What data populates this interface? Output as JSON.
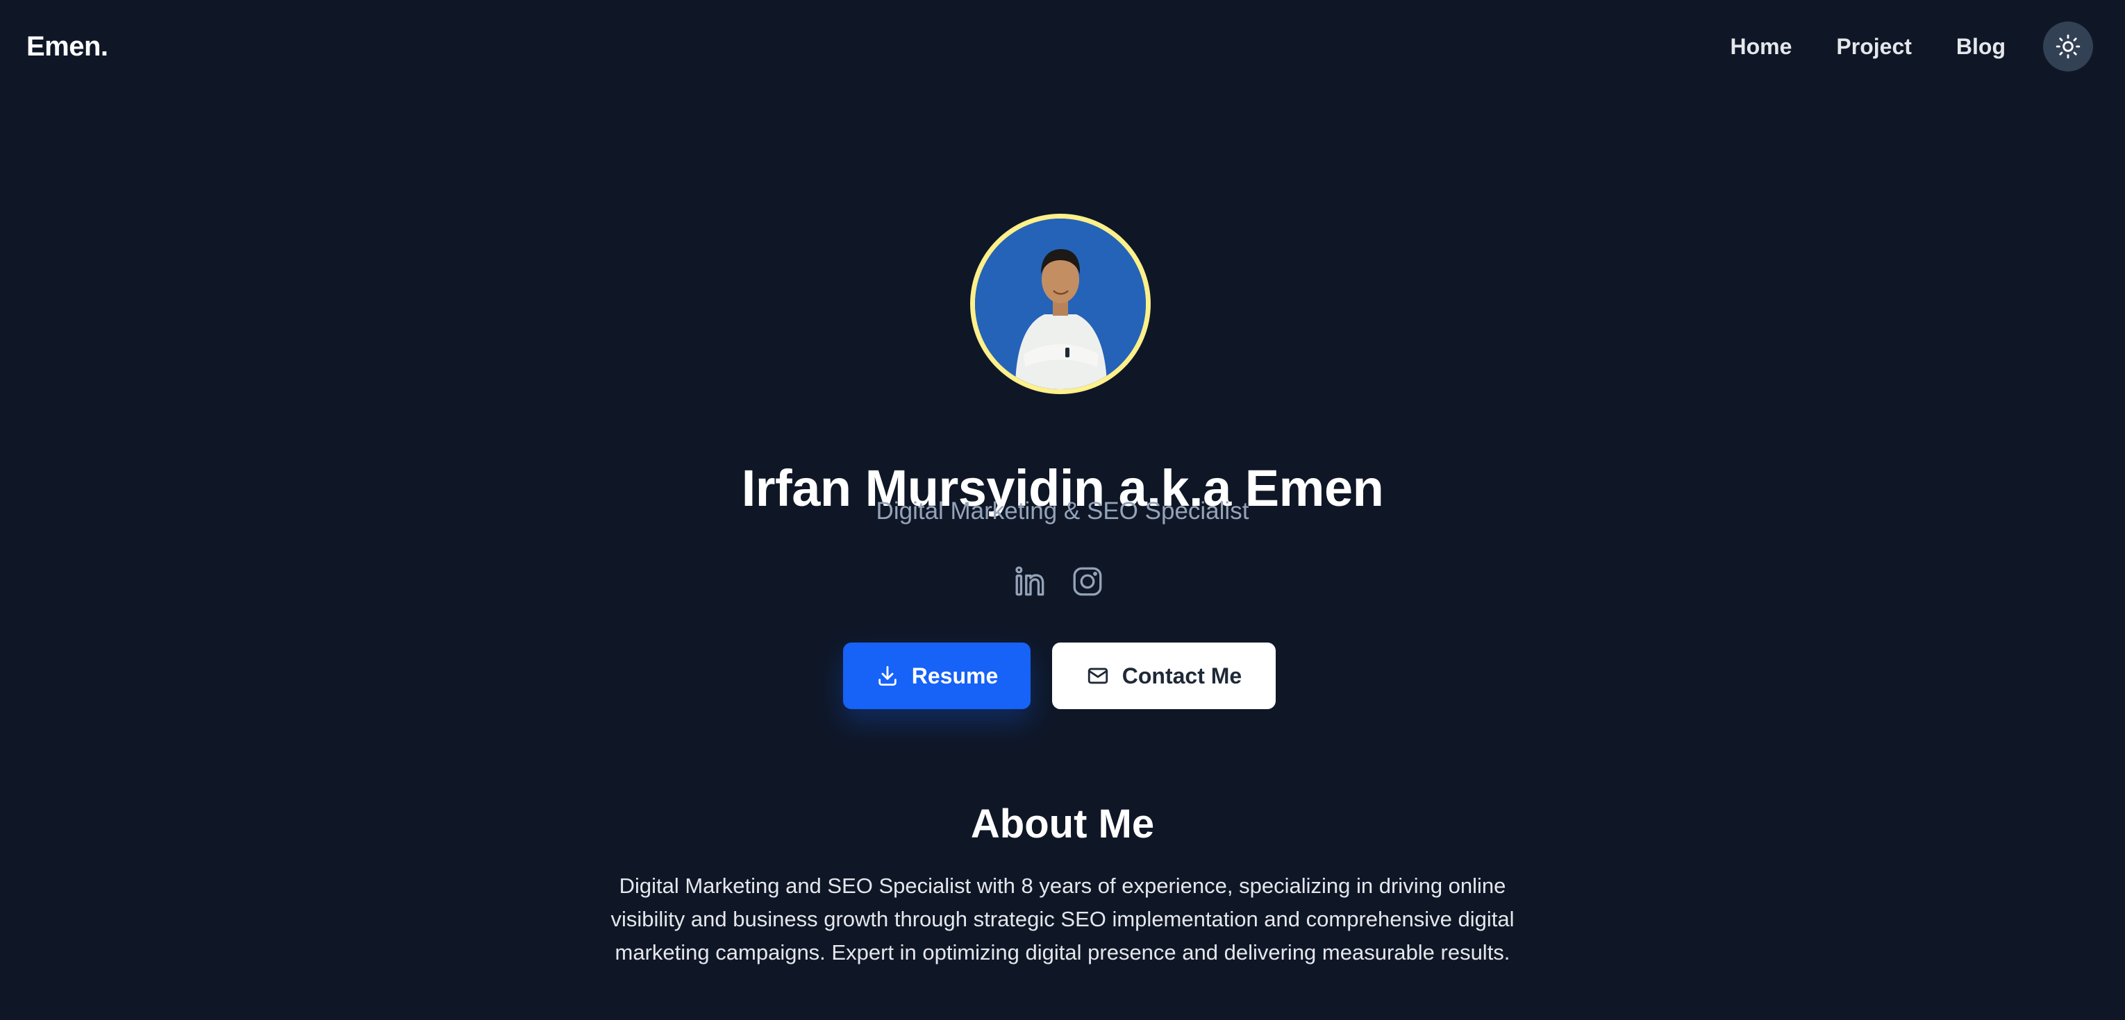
{
  "header": {
    "logo": "Emen.",
    "nav": [
      {
        "label": "Home"
      },
      {
        "label": "Project"
      },
      {
        "label": "Blog"
      }
    ],
    "theme_toggle_icon": "sun-icon"
  },
  "profile": {
    "name": "Irfan Mursyidin a.k.a Emen",
    "tagline": "Digital Marketing & SEO Specialist",
    "avatar_ring_color": "#fef08a",
    "avatar_bg_color": "#2563b8",
    "socials": [
      {
        "icon": "linkedin-icon"
      },
      {
        "icon": "instagram-icon"
      }
    ]
  },
  "actions": {
    "resume_label": "Resume",
    "resume_icon": "download-icon",
    "contact_label": "Contact Me",
    "contact_icon": "mail-icon"
  },
  "about": {
    "title": "About Me",
    "text": "Digital Marketing and SEO Specialist with 8 years of experience, specializing in driving online visibility and business growth through strategic SEO implementation and comprehensive digital marketing campaigns. Expert in optimizing digital presence and delivering measurable results."
  },
  "colors": {
    "background": "#0f1727",
    "primary": "#1762f7",
    "muted_text": "#94a3b8"
  }
}
